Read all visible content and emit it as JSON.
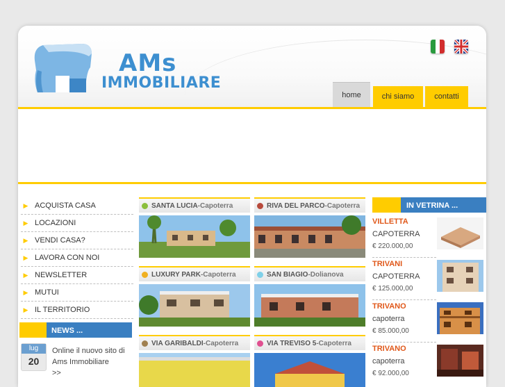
{
  "brand": {
    "line1": "AMs",
    "line2": "IMMOBILIARE"
  },
  "nav": {
    "home": "home",
    "chi_siamo": "chi siamo",
    "contatti": "contatti"
  },
  "languages": [
    "italian-flag",
    "uk-flag"
  ],
  "colors": {
    "accent": "#ffcc00",
    "blue": "#3a7fc1",
    "orange": "#e0581a"
  },
  "sidebar": {
    "items": [
      {
        "label": "ACQUISTA CASA"
      },
      {
        "label": "LOCAZIONI"
      },
      {
        "label": "VENDI CASA?"
      },
      {
        "label": "LAVORA CON NOI"
      },
      {
        "label": "NEWSLETTER"
      },
      {
        "label": "MUTUI"
      },
      {
        "label": "IL TERRITORIO"
      }
    ]
  },
  "news": {
    "heading": "NEWS ...",
    "month": "lug",
    "day": "20",
    "text": "Online il nuovo sito di Ams Immobiliare",
    "more": ">>"
  },
  "cards": [
    {
      "name": "SANTA LUCIA",
      "sep": " - ",
      "place": "Capoterra",
      "dot": "#8bbf3c"
    },
    {
      "name": "RIVA DEL PARCO",
      "sep": " - ",
      "place": "Capoterra",
      "dot": "#b84a3c"
    },
    {
      "name": "LUXURY PARK",
      "sep": " - ",
      "place": "Capoterra",
      "dot": "#f0b020"
    },
    {
      "name": "SAN BIAGIO",
      "sep": " - ",
      "place": "Dolianova",
      "dot": "#7fd0e8"
    },
    {
      "name": "VIA GARIBALDI",
      "sep": " - ",
      "place": "Capoterra",
      "dot": "#a08050"
    },
    {
      "name": "VIA TREVISO 5",
      "sep": " - ",
      "place": "Capoterra",
      "dot": "#e05090"
    }
  ],
  "vetrina": {
    "heading": "IN VETRINA ...",
    "items": [
      {
        "title": "VILLETTA",
        "city": "CAPOTERRA",
        "price": "€ 220.000,00"
      },
      {
        "title": "TRIVANI",
        "city": "CAPOTERRA",
        "price": "€ 125.000,00"
      },
      {
        "title": "TRIVANO",
        "city": "capoterra",
        "price": "€ 85.000,00"
      },
      {
        "title": "TRIVANO",
        "city": "capoterra",
        "price": "€ 92.000,00"
      }
    ]
  }
}
